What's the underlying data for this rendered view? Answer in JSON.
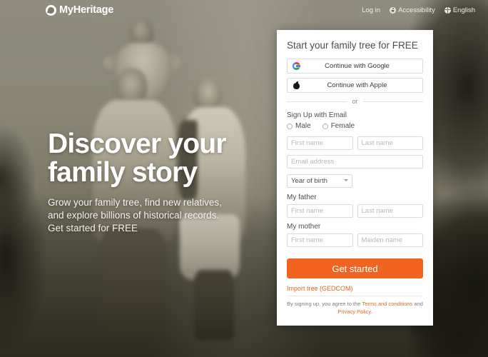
{
  "header": {
    "logo_text": "MyHeritage",
    "logo_icon": "myheritage-leaf-icon",
    "nav": [
      {
        "label": "Log in",
        "icon": null
      },
      {
        "label": "Accessibility",
        "icon": "accessibility-icon"
      },
      {
        "label": "English",
        "icon": "globe-icon"
      }
    ]
  },
  "hero": {
    "title_line1": "Discover your",
    "title_line2": "family story",
    "sub_line1": "Grow your family tree, find new relatives,",
    "sub_line2": "and explore billions of historical records.",
    "sub_line3": "Get started for FREE"
  },
  "signup": {
    "title": "Start your family tree for FREE",
    "oauth": [
      {
        "label": "Continue with Google",
        "icon": "google-icon"
      },
      {
        "label": "Continue with Apple",
        "icon": "apple-icon"
      }
    ],
    "divider_text": "or",
    "email_section_label": "Sign Up with Email",
    "gender": [
      {
        "label": "Male",
        "selected": false
      },
      {
        "label": "Female",
        "selected": false
      }
    ],
    "fields": {
      "first_name_placeholder": "First name",
      "last_name_placeholder": "Last name",
      "email_placeholder": "Email address",
      "year_of_birth_value": "Year of birth",
      "father_first_placeholder": "First name",
      "father_last_placeholder": "Last name",
      "mother_first_placeholder": "First name",
      "mother_maiden_placeholder": "Maiden name"
    },
    "father_label": "My father",
    "mother_label": "My mother",
    "cta_label": "Get started",
    "import_link": "Import tree (GEDCOM)",
    "legal_prefix": "By signing up, you agree to the ",
    "legal_terms": "Terms and conditions",
    "legal_and": " and ",
    "legal_privacy": "Privacy Policy",
    "legal_suffix": ".",
    "accent_color": "#f26322"
  }
}
